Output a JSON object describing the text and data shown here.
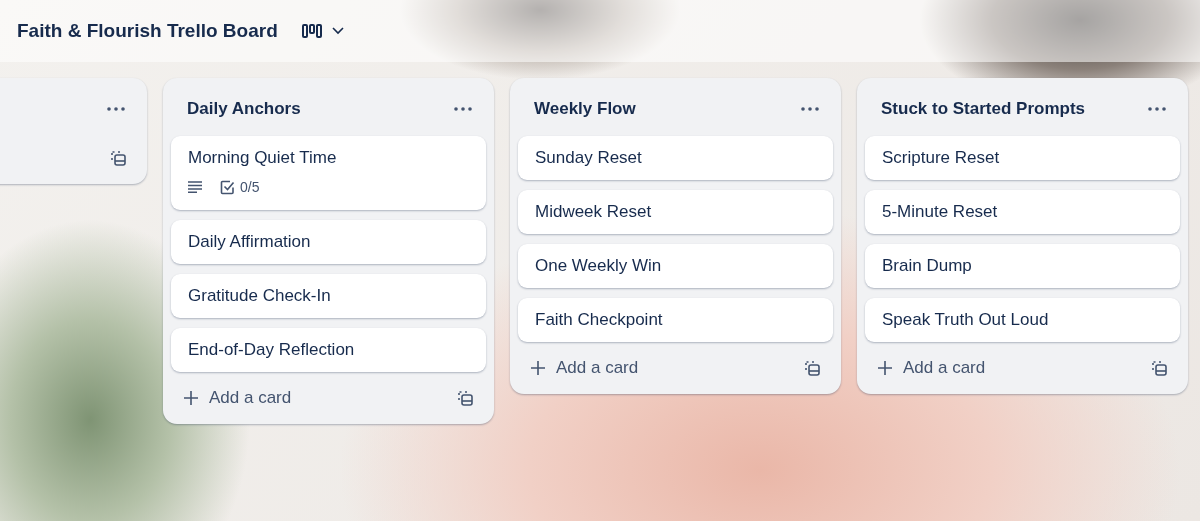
{
  "board": {
    "title": "Faith & Flourish Trello Board"
  },
  "lists": [
    {
      "cut_off": true
    },
    {
      "title": "Daily Anchors",
      "cards": [
        {
          "title": "Morning Quiet Time",
          "has_description": true,
          "checklist": "0/5"
        },
        {
          "title": "Daily Affirmation",
          "has_description": false
        },
        {
          "title": "Gratitude Check-In",
          "has_description": false
        },
        {
          "title": "End-of-Day Reflection",
          "has_description": false
        }
      ],
      "add_label": "Add a card"
    },
    {
      "title": "Weekly Flow",
      "cards": [
        {
          "title": "Sunday Reset",
          "has_description": false
        },
        {
          "title": "Midweek Reset",
          "has_description": false
        },
        {
          "title": "One Weekly Win",
          "has_description": false
        },
        {
          "title": "Faith Checkpoint",
          "has_description": false
        }
      ],
      "add_label": "Add a card"
    },
    {
      "title": "Stuck to Started Prompts",
      "cards": [
        {
          "title": "Scripture Reset",
          "has_description": false
        },
        {
          "title": "5-Minute Reset",
          "has_description": false
        },
        {
          "title": "Brain Dump",
          "has_description": false
        },
        {
          "title": "Speak Truth Out Loud",
          "has_description": false
        }
      ],
      "add_label": "Add a card"
    }
  ]
}
